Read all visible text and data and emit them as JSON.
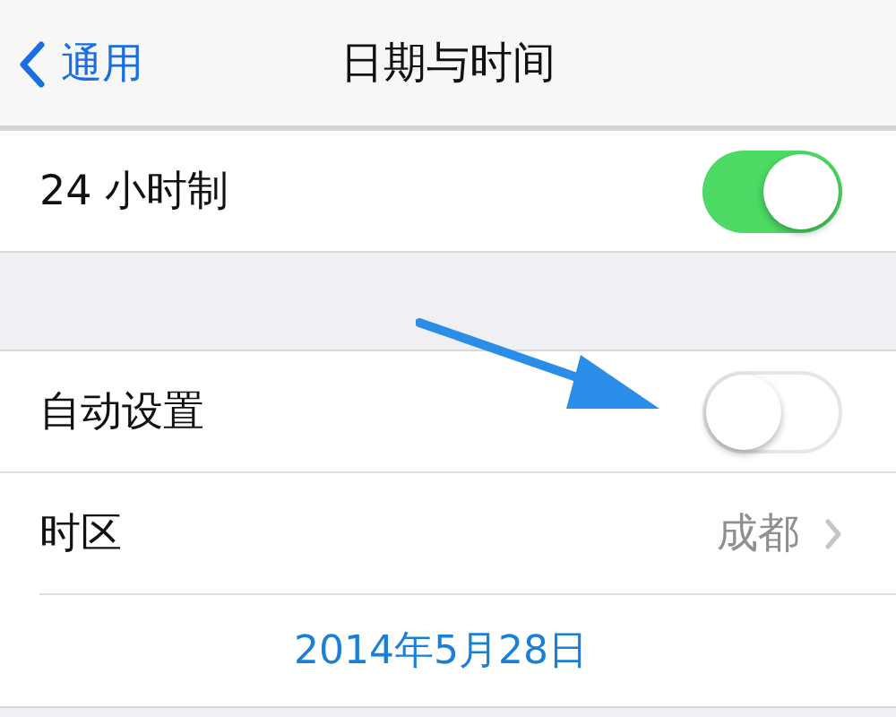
{
  "nav": {
    "back_label": "通用",
    "title": "日期与时间"
  },
  "sections": [
    {
      "rows": [
        {
          "kind": "switch",
          "label": "24 小时制",
          "on": true
        }
      ]
    },
    {
      "rows": [
        {
          "kind": "switch",
          "label": "自动设置",
          "on": false
        },
        {
          "kind": "detail",
          "label": "时区",
          "value": "成都"
        },
        {
          "kind": "date",
          "value": "2014年5月28日"
        }
      ]
    }
  ]
}
